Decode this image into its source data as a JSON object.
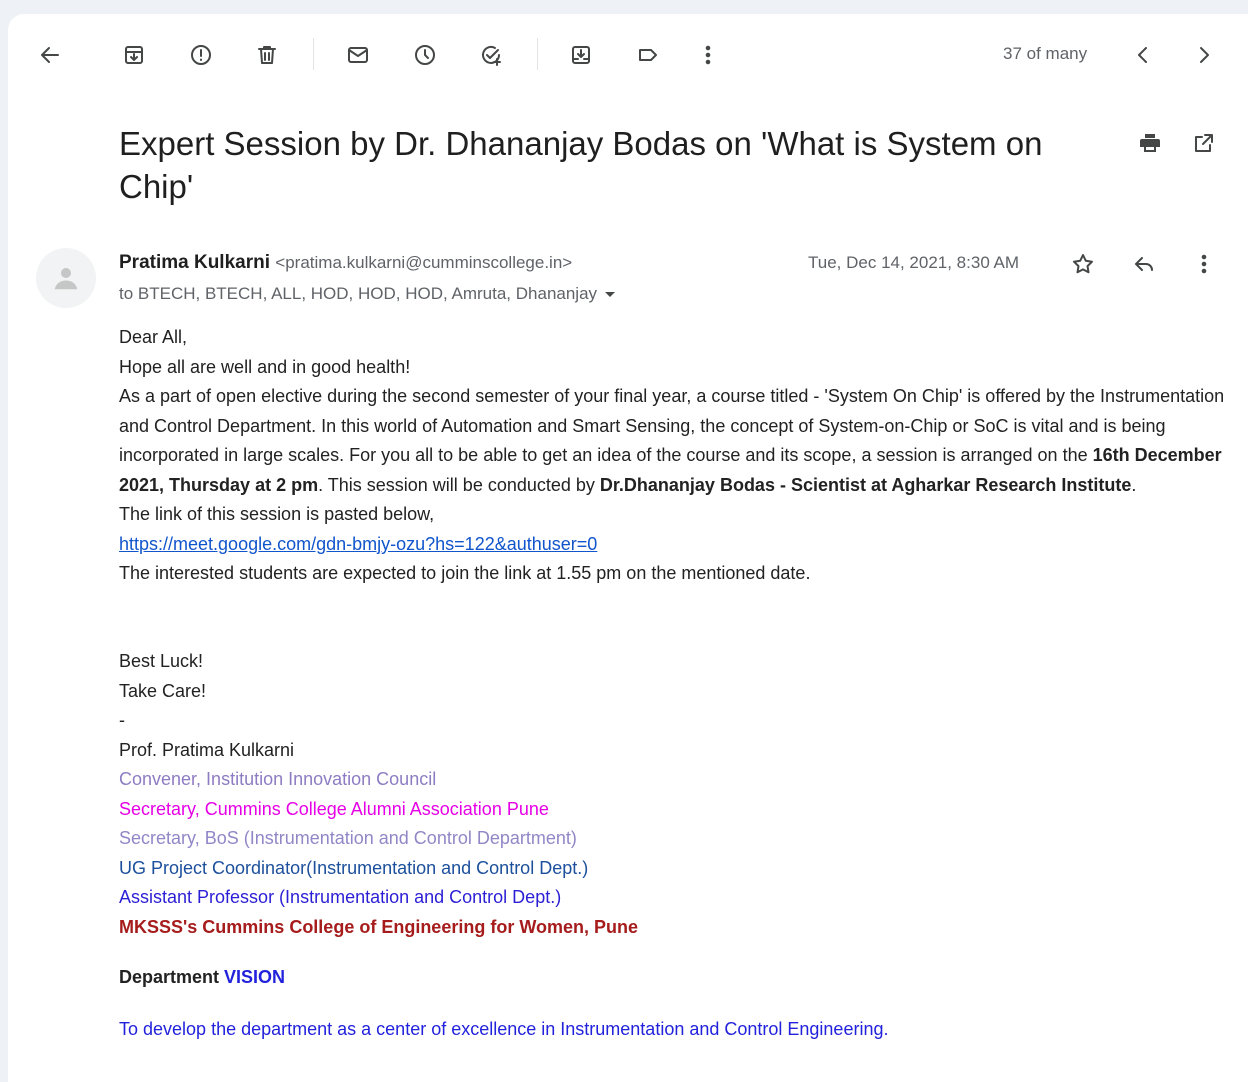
{
  "toolbar": {
    "counter": "37 of many"
  },
  "email": {
    "subject": "Expert Session by Dr. Dhananjay Bodas on 'What is System on Chip'",
    "sender_name": "Pratima Kulkarni",
    "sender_email": "<pratima.kulkarni@cumminscollege.in>",
    "recipients": "to BTECH, BTECH, ALL, HOD, HOD, HOD, Amruta, Dhananjay",
    "date": "Tue, Dec 14, 2021, 8:30 AM"
  },
  "body": {
    "greeting": "Dear All,",
    "line1": "Hope all are well and in good health!",
    "para_a": "As a part of open elective during the second semester of your final year, a course titled - 'System On Chip' is offered by the Instrumentation and Control Department. In this world of Automation and Smart Sensing, the concept of System-on-Chip or SoC is vital and is being incorporated in large scales. For you all to be able to get an idea of the course and its scope, a session is arranged on the ",
    "para_date": "16th December 2021, Thursday at 2 pm",
    "para_b": ". This session will be conducted by ",
    "para_speaker": "Dr.Dhananjay Bodas - Scientist at Agharkar Research Institute",
    "para_end": ".",
    "link_intro": "The link of this session is pasted below,",
    "link": "https://meet.google.com/gdn-bmjy-ozu?hs=122&authuser=0",
    "join_note": "The interested students are expected to join the link at 1.55 pm on the mentioned date.",
    "closing1": "Best Luck!",
    "closing2": "Take Care!",
    "dash": "-"
  },
  "signature": {
    "name": "Prof. Pratima Kulkarni",
    "role1": "Convener, Institution Innovation Council",
    "role2": "Secretary, Cummins College Alumni Association Pune",
    "role3": "Secretary, BoS (Instrumentation and Control Department)",
    "role4": "UG Project Coordinator(Instrumentation and Control Dept.)",
    "role5": "Assistant Professor (Instrumentation and Control Dept.)",
    "org": "MKSSS's Cummins College of  Engineering for Women, Pune",
    "vision_label": "Department ",
    "vision_word": "VISION",
    "vision_text": "To develop the department as a center of excellence in Instrumentation and Control Engineering."
  },
  "colors": {
    "link": "#1155cc",
    "org": "#a61c1c",
    "vision": "#2222dd",
    "role2": "#e600e6"
  }
}
